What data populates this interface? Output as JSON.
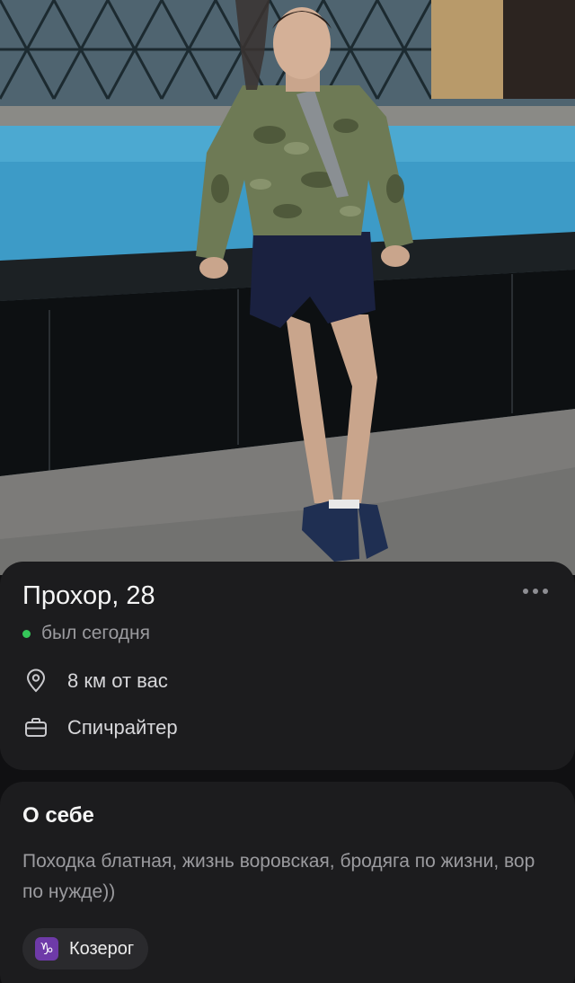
{
  "profile": {
    "name_age": "Прохор, 28",
    "status": "был сегодня",
    "distance": "8 км от вас",
    "job": "Спичрайтер",
    "status_color": "#35c759"
  },
  "about": {
    "title": "О себе",
    "text": "Походка блатная, жизнь воровская, бродяга по жизни, вор по нужде))"
  },
  "zodiac": {
    "symbol": "♑",
    "label": "Козерог",
    "accent": "#6e3aa8"
  },
  "icons": {
    "more": "more-horizontal-icon",
    "location": "location-pin-icon",
    "job": "briefcase-icon"
  }
}
